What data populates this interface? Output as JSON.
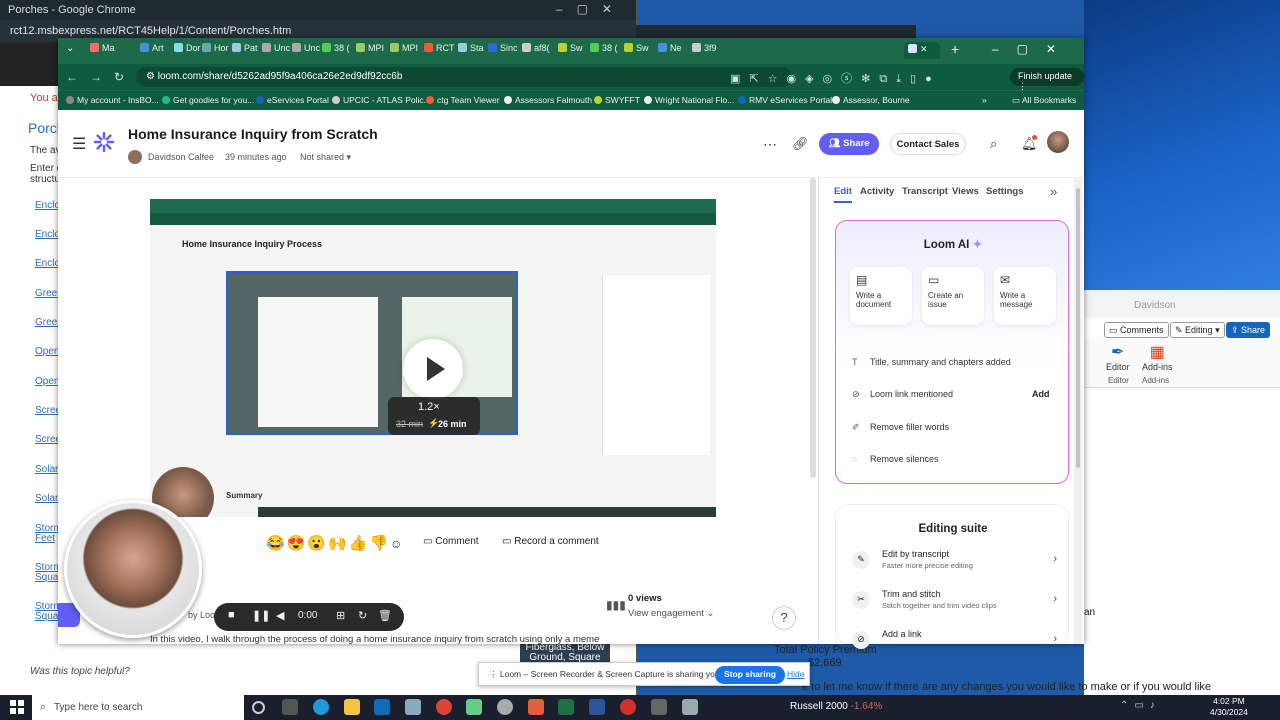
{
  "bg_window": {
    "title": "Porches - Google Chrome",
    "url": "rct12.msbexpress.net/RCT45Help/1/Content/Porches.htm",
    "you_are": "You are",
    "heading": "Porch",
    "para1": "The ava",
    "para2": "Enter ei",
    "para3": "structure",
    "links": [
      "Enclos",
      "Enclos",
      "Enclos",
      "Green",
      "Green",
      "Open",
      "Open",
      "Screen",
      "Screen",
      "Solar I",
      "Solar I",
      "Storm",
      "Feet",
      "Storm",
      "Squar",
      "Storm",
      "Squar"
    ],
    "helpful": "Was this topic helpful?",
    "caption": "Fiberglass, Below Ground, Square Feet"
  },
  "word_window": {
    "user": "Davidson",
    "comments_label": "Comments",
    "editing_label": "Editing",
    "share_label": "Share",
    "ribbon": [
      {
        "label": "Editor",
        "sub": "Editor"
      },
      {
        "label": "Add-ins",
        "sub": "Add-ins"
      }
    ],
    "doc_total_label": "Total Policy Premium",
    "doc_total_value": "$2,669",
    "doc_line": "e to let me know if there are any changes you would like to make or if you would like",
    "doc_fragment": "an"
  },
  "main_window": {
    "tabs": [
      "Ma",
      "Art",
      "Dor",
      "Hor",
      "Pat",
      "Unc",
      "Unc",
      "38 (",
      "MPI",
      "MPI",
      "RCT",
      "Sta",
      "Sinc",
      "af8(",
      "Sw",
      "38 (",
      "Sw",
      "Ne",
      "3f9"
    ],
    "url": "loom.com/share/d5262ad95f9a406ca26e2ed9df92cc6b",
    "finish_update": "Finish update",
    "bookmarks": [
      "My account - InsBO...",
      "Get goodies for you...",
      "eServices Portal",
      "UPCIC - ATLAS Polic...",
      "ctg Team Viewer",
      "Assessors Falmouth",
      "SWYFFT",
      "Wright National Flo...",
      "RMV eServices Portal",
      "Assessor, Bourne"
    ],
    "all_bookmarks": "All Bookmarks"
  },
  "loom": {
    "title": "Home Insurance Inquiry from Scratch",
    "author": "Davidson Calfee",
    "time_ago": "39 minutes ago",
    "visibility": "Not shared",
    "share_label": "Share",
    "contact_label": "Contact Sales",
    "video": {
      "inner_title": "Home Insurance Inquiry Process",
      "speed": "1.2×",
      "duration_original": "32 min",
      "duration_new": "26 min",
      "summary_label": "Summary"
    },
    "comment_label": "Comment",
    "record_comment_label": "Record a comment",
    "views_count": "0 views",
    "view_engagement": "View engagement",
    "by_loom": "by Loo",
    "description": "In this video, I walk through the process of doing a home insurance inquiry from scratch using only a meme"
  },
  "panel": {
    "tabs": [
      "Edit",
      "Activity",
      "Transcript",
      "Views",
      "Settings"
    ],
    "ai_title": "Loom AI",
    "ai_options": [
      "Write a document",
      "Create an issue",
      "Write a message"
    ],
    "ai_rows": [
      "Title, summary and chapters added",
      "Loom link mentioned",
      "Remove filler words",
      "Remove silences"
    ],
    "ai_add": "Add",
    "editing_title": "Editing suite",
    "editing_rows": [
      {
        "title": "Edit by transcript",
        "sub": "Faster more precise editing"
      },
      {
        "title": "Trim and stitch",
        "sub": "Stitch together and trim video clips"
      },
      {
        "title": "Add a link",
        "sub": ""
      }
    ]
  },
  "recorder": {
    "time": "0:00"
  },
  "sharing": {
    "text": "Loom – Screen Recorder & Screen Capture is sharing your screen.",
    "stop_label": "Stop sharing",
    "hide_label": "Hide"
  },
  "taskbar": {
    "search_placeholder": "Type here to search",
    "ticker_name": "Russell 2000",
    "ticker_value": "-1.64%",
    "time": "4:02 PM",
    "date": "4/30/2024"
  }
}
